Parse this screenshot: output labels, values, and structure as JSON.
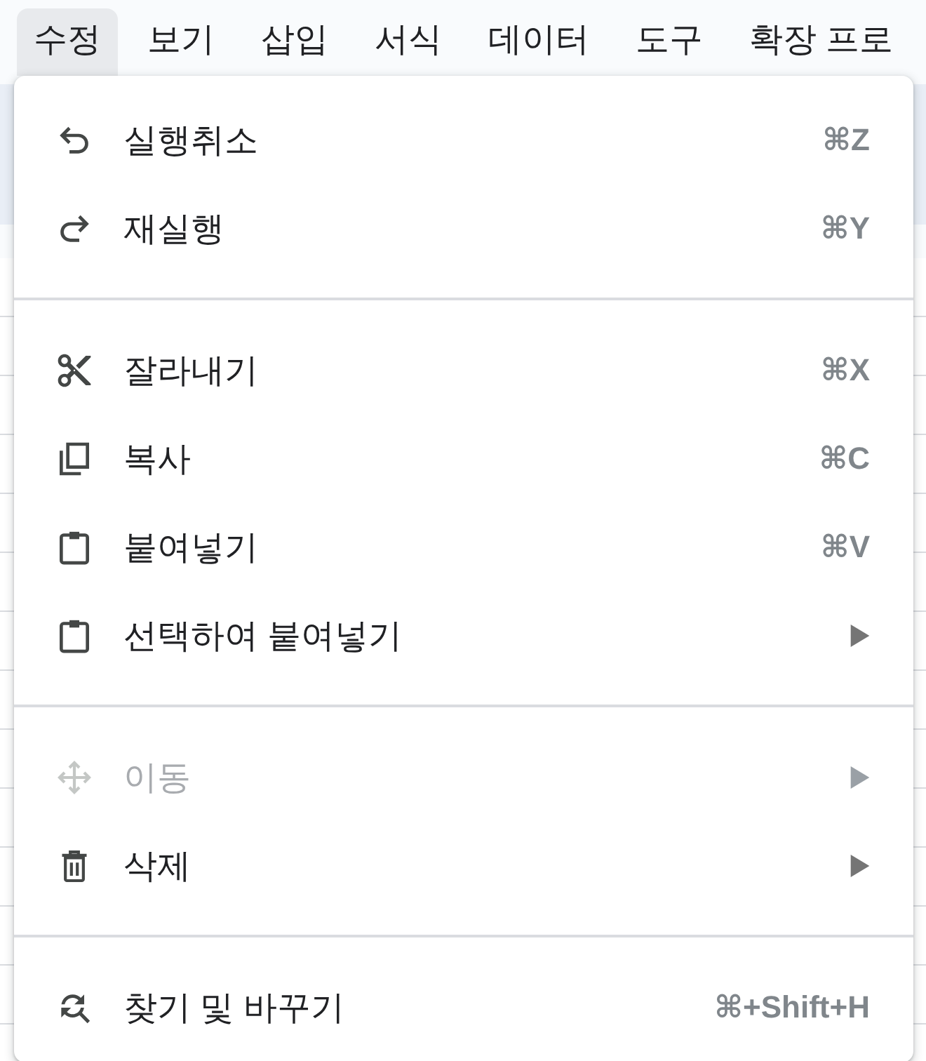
{
  "menu_bar": {
    "items": [
      {
        "label": "수정",
        "selected": true
      },
      {
        "label": "보기",
        "selected": false
      },
      {
        "label": "삽입",
        "selected": false
      },
      {
        "label": "서식",
        "selected": false
      },
      {
        "label": "데이터",
        "selected": false
      },
      {
        "label": "도구",
        "selected": false
      },
      {
        "label": "확장 프로",
        "selected": false
      }
    ]
  },
  "menu": {
    "sections": [
      {
        "items": [
          {
            "label": "실행취소",
            "shortcut": "⌘Z",
            "submenu": false,
            "disabled": false
          },
          {
            "label": "재실행",
            "shortcut": "⌘Y",
            "submenu": false,
            "disabled": false
          }
        ]
      },
      {
        "items": [
          {
            "label": "잘라내기",
            "shortcut": "⌘X",
            "submenu": false,
            "disabled": false
          },
          {
            "label": "복사",
            "shortcut": "⌘C",
            "submenu": false,
            "disabled": false
          },
          {
            "label": "붙여넣기",
            "shortcut": "⌘V",
            "submenu": false,
            "disabled": false
          },
          {
            "label": "선택하여 붙여넣기",
            "submenu": true,
            "disabled": false
          }
        ]
      },
      {
        "items": [
          {
            "label": "이동",
            "submenu": true,
            "disabled": true
          },
          {
            "label": "삭제",
            "submenu": true,
            "disabled": false
          }
        ]
      },
      {
        "items": [
          {
            "label": "찾기 및 바꾸기",
            "shortcut": "⌘+Shift+H",
            "submenu": false,
            "disabled": false
          }
        ]
      }
    ]
  }
}
